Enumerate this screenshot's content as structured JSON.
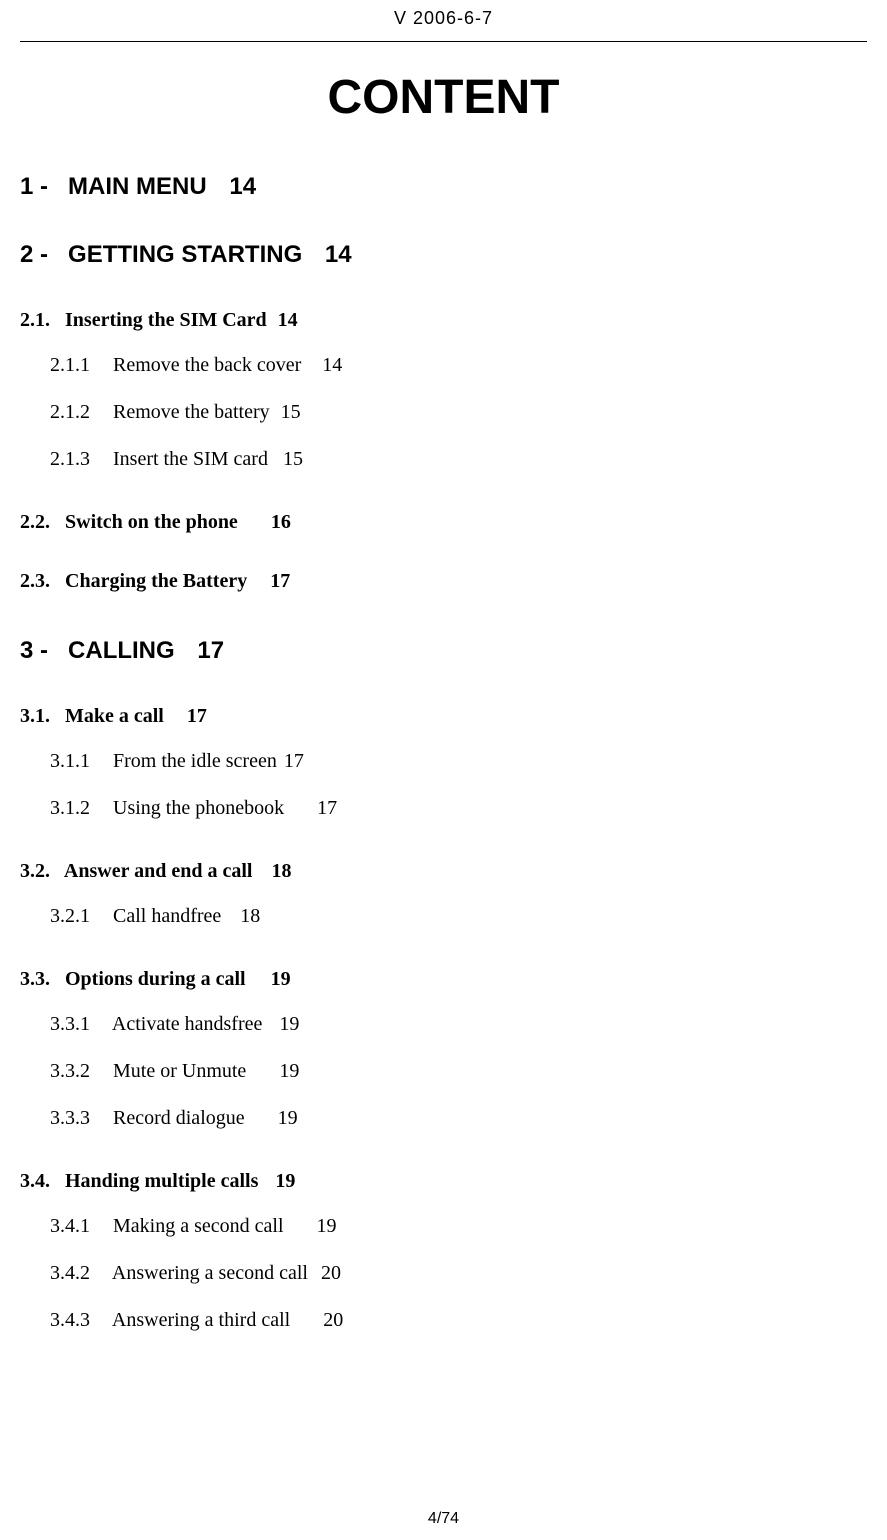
{
  "header": {
    "version": "V 2006-6-7"
  },
  "title": "CONTENT",
  "toc": {
    "s1": {
      "num": "1",
      "title": "MAIN MENU",
      "page": "14"
    },
    "s2": {
      "num": "2",
      "title": "GETTING STARTING",
      "page": "14"
    },
    "s2_1": {
      "num": "2.1",
      "title": "Inserting the SIM Card",
      "page": "14"
    },
    "s2_1_1": {
      "num": "2.1.1",
      "title": "Remove the back cover",
      "page": "14"
    },
    "s2_1_2": {
      "num": "2.1.2",
      "title": "Remove the battery",
      "page": "15"
    },
    "s2_1_3": {
      "num": "2.1.3",
      "title": "Insert the SIM card",
      "page": "15"
    },
    "s2_2": {
      "num": "2.2",
      "title": "Switch on the phone",
      "page": "16"
    },
    "s2_3": {
      "num": "2.3",
      "title": "Charging the Battery",
      "page": "17"
    },
    "s3": {
      "num": "3",
      "title": "CALLING",
      "page": "17"
    },
    "s3_1": {
      "num": "3.1",
      "title": "Make a call",
      "page": "17"
    },
    "s3_1_1": {
      "num": "3.1.1",
      "title": "From the idle screen",
      "page": "17"
    },
    "s3_1_2": {
      "num": "3.1.2",
      "title": "Using the phonebook",
      "page": "17"
    },
    "s3_2": {
      "num": "3.2",
      "title": "Answer and end a call",
      "page": "18"
    },
    "s3_2_1": {
      "num": "3.2.1",
      "title": "Call handfree",
      "page": "18"
    },
    "s3_3": {
      "num": "3.3",
      "title": "Options during a call",
      "page": "19"
    },
    "s3_3_1": {
      "num": "3.3.1",
      "title": "Activate handsfree",
      "page": "19"
    },
    "s3_3_2": {
      "num": "3.3.2",
      "title": "Mute or Unmute",
      "page": "19"
    },
    "s3_3_3": {
      "num": "3.3.3",
      "title": "Record dialogue",
      "page": "19"
    },
    "s3_4": {
      "num": "3.4",
      "title": "Handing multiple calls",
      "page": "19"
    },
    "s3_4_1": {
      "num": "3.4.1",
      "title": "Making a second call",
      "page": "19"
    },
    "s3_4_2": {
      "num": "3.4.2",
      "title": "Answering a second call",
      "page": "20"
    },
    "s3_4_3": {
      "num": "3.4.3",
      "title": "Answering a third call",
      "page": "20"
    }
  },
  "footer": {
    "page_indicator": "4/74"
  }
}
